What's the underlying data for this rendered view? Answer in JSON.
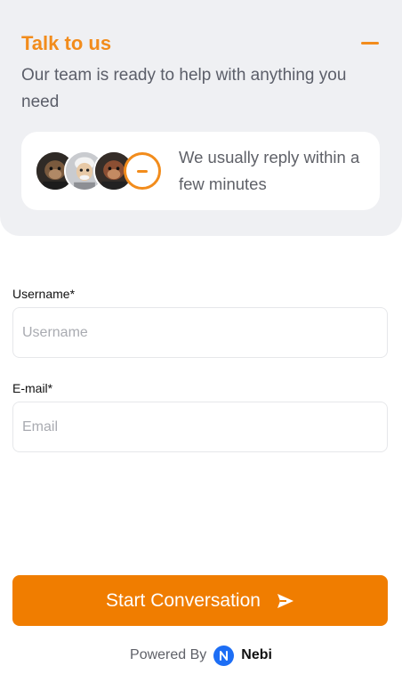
{
  "header": {
    "title": "Talk to us",
    "subtitle": "Our team is ready to help with anything you need",
    "collapse_icon": "minus-icon",
    "accent_color": "#f28c1c",
    "background_color": "#eff0f3"
  },
  "reply_card": {
    "text": "We usually reply within a few minutes",
    "avatars": [
      "avatar-ape",
      "avatar-elder",
      "avatar-ape-red"
    ],
    "more_icon": "minus-circle-icon"
  },
  "form": {
    "username": {
      "label": "Username*",
      "placeholder": "Username",
      "value": ""
    },
    "email": {
      "label": "E-mail*",
      "placeholder": "Email",
      "value": ""
    }
  },
  "start_button": {
    "label": "Start Conversation",
    "icon": "send-icon",
    "color": "#f07d00"
  },
  "footer": {
    "powered_by": "Powered By",
    "brand": "Nebi",
    "brand_icon": "nebi-logo-icon",
    "brand_color": "#1d6ef5"
  }
}
